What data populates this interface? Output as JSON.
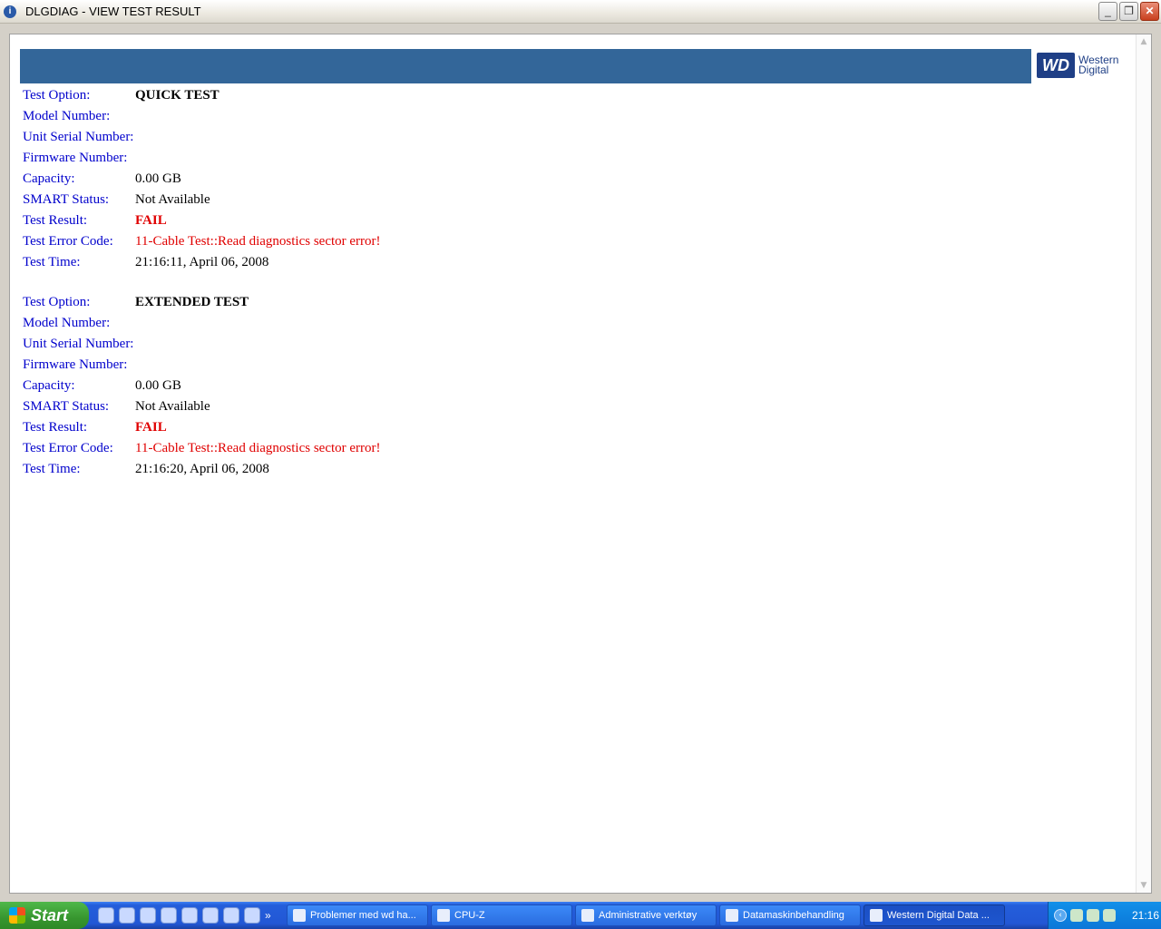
{
  "window": {
    "title": "DLGDIAG - VIEW TEST RESULT",
    "title_icon": "i",
    "buttons": {
      "minimize": "_",
      "maximize": "❐",
      "close": "✕"
    }
  },
  "logo": {
    "mark": "WD",
    "line1": "Western",
    "line2": "Digital"
  },
  "tests": [
    {
      "rows": [
        {
          "label": "Test Option:",
          "value": "QUICK TEST"
        },
        {
          "label": "Model Number:",
          "value": ""
        },
        {
          "label": "Unit Serial Number:",
          "value": ""
        },
        {
          "label": "Firmware Number:",
          "value": ""
        },
        {
          "label": "Capacity:",
          "value": "0.00 GB"
        },
        {
          "label": "SMART Status:",
          "value": "Not Available"
        },
        {
          "label": "Test Result:",
          "value": "FAIL"
        },
        {
          "label": "Test Error Code:",
          "value": "11-Cable Test::Read diagnostics sector error!"
        },
        {
          "label": "Test Time:",
          "value": "21:16:11, April 06, 2008"
        }
      ]
    },
    {
      "rows": [
        {
          "label": "Test Option:",
          "value": "EXTENDED TEST"
        },
        {
          "label": "Model Number:",
          "value": ""
        },
        {
          "label": "Unit Serial Number:",
          "value": ""
        },
        {
          "label": "Firmware Number:",
          "value": ""
        },
        {
          "label": "Capacity:",
          "value": "0.00 GB"
        },
        {
          "label": "SMART Status:",
          "value": "Not Available"
        },
        {
          "label": "Test Result:",
          "value": "FAIL"
        },
        {
          "label": "Test Error Code:",
          "value": "11-Cable Test::Read diagnostics sector error!"
        },
        {
          "label": "Test Time:",
          "value": "21:16:20, April 06, 2008"
        }
      ]
    }
  ],
  "colors": {
    "banner": "#336699",
    "label": "#0000cc",
    "error": "#e00000"
  },
  "taskbar": {
    "start_label": "Start",
    "quicklaunch_more": "»",
    "tasks": [
      "Problemer med wd ha...",
      "CPU-Z",
      "Administrative verktøy",
      "Datamaskinbehandling",
      "Western Digital Data ..."
    ],
    "clock": "21:16"
  }
}
